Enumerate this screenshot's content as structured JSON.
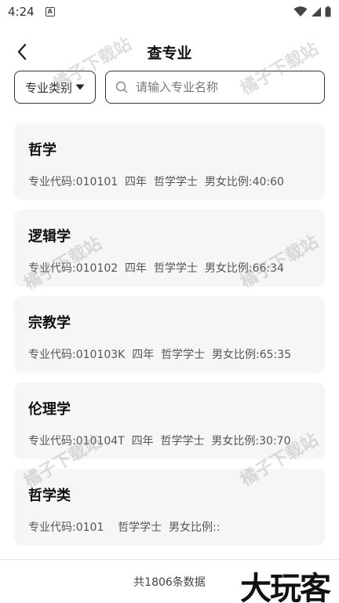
{
  "status": {
    "time": "4:24",
    "indicator": "A"
  },
  "header": {
    "title": "查专业"
  },
  "filter": {
    "category_label": "专业类别"
  },
  "search": {
    "placeholder": "请输入专业名称"
  },
  "majors": [
    {
      "name": "哲学",
      "info": "专业代码:010101  四年  哲学学士  男女比例:40:60"
    },
    {
      "name": "逻辑学",
      "info": "专业代码:010102  四年  哲学学士  男女比例:66:34"
    },
    {
      "name": "宗教学",
      "info": "专业代码:010103K  四年  哲学学士  男女比例:65:35"
    },
    {
      "name": "伦理学",
      "info": "专业代码:010104T  四年  哲学学士  男女比例:30:70"
    },
    {
      "name": "哲学类",
      "info": "专业代码:0101    哲学学士  男女比例::"
    }
  ],
  "footer": {
    "count_text": "共1806条数据",
    "logo_text": "大玩客"
  },
  "watermark": {
    "text": "橘子下载站"
  },
  "icons": {
    "back": "chevron-left-icon",
    "dropdown": "caret-down-icon",
    "search": "search-icon"
  }
}
